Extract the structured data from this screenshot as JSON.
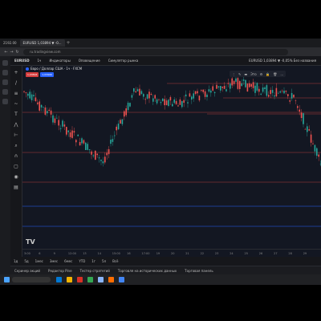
{
  "browser": {
    "tabs": [
      {
        "label": "2192.00"
      },
      {
        "label": "EURUSD 1,03894 ▼ -0..."
      }
    ],
    "url": "ru.tradingview.com"
  },
  "tv_toolbar": {
    "symbol": "EURUSD",
    "interval": "1ч",
    "items": [
      "Индикаторы",
      "Оповещение",
      "Симулятор рынка"
    ],
    "status": "EURUSD 1,03894 ▼ -0,05% Без названия"
  },
  "chart": {
    "legend": "Евро / Доллар США · 1ч · FXCM",
    "sell_price": "1,03894",
    "buy_price": "1,03906",
    "drawbar_items": [
      "Это"
    ],
    "logo": "TV",
    "time_ticks": [
      "3:00",
      "6",
      "9",
      "12:00",
      "13",
      "14",
      "15:00",
      "16",
      "17:00",
      "19",
      "20",
      "21",
      "22",
      "23",
      "24",
      "25",
      "26",
      "27",
      "28",
      "29"
    ]
  },
  "chart_data": {
    "type": "candlestick",
    "colors": {
      "up": "#26a69a",
      "down": "#ef5350",
      "hline_red": "#b23b3b",
      "hline_blue": "#2962ff",
      "background": "#131722"
    }
  },
  "range_bar": [
    "1д",
    "5д",
    "1мес",
    "3мес",
    "6мес",
    "YTD",
    "1г",
    "5л",
    "Всё"
  ],
  "panel_bar": [
    "Скринер акций",
    "Редактор Pine",
    "Тестер стратегий",
    "Торговля на исторических данных",
    "Торговая панель"
  ],
  "taskbar": {
    "icon_colors": [
      "#0078d4",
      "#f4b400",
      "#d93025",
      "#34a853",
      "#8ab4f8",
      "#ff6d00",
      "#4285f4"
    ]
  }
}
